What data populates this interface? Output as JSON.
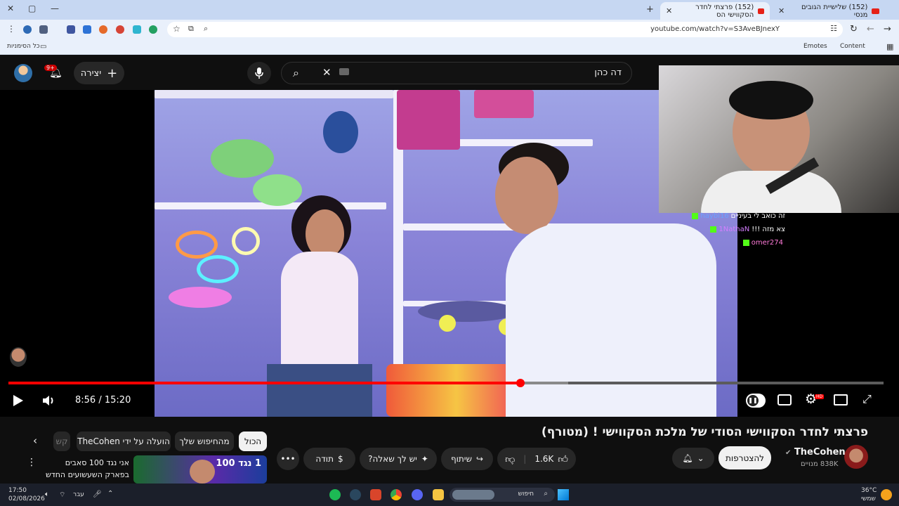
{
  "browser": {
    "tabs": [
      {
        "label": "(152) פרצתי לחדר הסקווישי הס",
        "active": true
      },
      {
        "label": "(152) שלישיית הגובים מנסי",
        "active": false
      }
    ],
    "url": "youtube.com/watch?v=S3AveBJnexY",
    "bookmarks_all": "כל הסימניות",
    "bookmark_emotes": "Emotes",
    "bookmark_content": "Content"
  },
  "youtube": {
    "search_value": "דה כהן",
    "create_label": "יצירה",
    "notif_count": "9+",
    "video": {
      "time_current": "8:56",
      "time_total": "15:20",
      "time_separator": "/",
      "progress": 0.585,
      "buffered": 0.64,
      "hd_badge": "HD"
    },
    "chat": [
      {
        "user": "haybi16",
        "text": "זה כואב לי בעיניים"
      },
      {
        "user": "1NathaN",
        "text": "צא מזה !!!"
      },
      {
        "user": "omer274",
        "text": ""
      }
    ],
    "title": "פרצתי לחדר הסקווישי הסודי של מלכת הסקווישי ! (מטורף)",
    "channel": {
      "name": "TheCohen",
      "subs": "838K מנויים",
      "subscribe_label": "להצטרפות"
    },
    "actions": {
      "likes": "1.6K",
      "share": "שיתוף",
      "ask": "יש לך שאלה?",
      "thanks": "תודה"
    },
    "chips": [
      "הכול",
      "מהחיפוש שלך",
      "הועלה על ידי TheCohen",
      "קש"
    ],
    "suggested": {
      "title": "אני נגד 100 סאבים בפארק השעשועים החדש שלי!",
      "thumb_text": "1 נגד 100"
    }
  },
  "taskbar": {
    "time": "17:50",
    "date": "02/08/2026",
    "search_placeholder": "חיפוש",
    "lang": "עבר",
    "weather_temp": "36°C",
    "weather_desc": "שמשי"
  },
  "colors": {
    "accent": "#ff0000",
    "yt_bg": "#0f0f0f",
    "chrome_tab": "#c6d7f2"
  }
}
